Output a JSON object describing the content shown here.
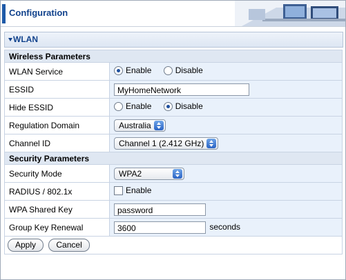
{
  "header": {
    "title": "Configuration"
  },
  "section": {
    "title": "WLAN"
  },
  "groups": {
    "wireless": "Wireless Parameters",
    "security": "Security Parameters"
  },
  "rows": {
    "wlan_service": {
      "label": "WLAN Service",
      "options": [
        "Enable",
        "Disable"
      ],
      "selected": "Enable"
    },
    "essid": {
      "label": "ESSID",
      "value": "MyHomeNetwork"
    },
    "hide_essid": {
      "label": "Hide ESSID",
      "options": [
        "Enable",
        "Disable"
      ],
      "selected": "Disable"
    },
    "regulation_domain": {
      "label": "Regulation Domain",
      "value": "Australia"
    },
    "channel_id": {
      "label": "Channel ID",
      "value": "Channel 1 (2.412 GHz)"
    },
    "security_mode": {
      "label": "Security Mode",
      "value": "WPA2"
    },
    "radius": {
      "label": "RADIUS / 802.1x",
      "checkbox_label": "Enable",
      "checked": false
    },
    "wpa_key": {
      "label": "WPA Shared Key",
      "value": "password"
    },
    "group_key_renewal": {
      "label": "Group Key Renewal",
      "value": "3600",
      "units": "seconds"
    }
  },
  "buttons": {
    "apply": "Apply",
    "cancel": "Cancel"
  },
  "colors": {
    "accent": "#1e5aa8",
    "title": "#11428c",
    "value_bg": "#e9f1fb"
  }
}
